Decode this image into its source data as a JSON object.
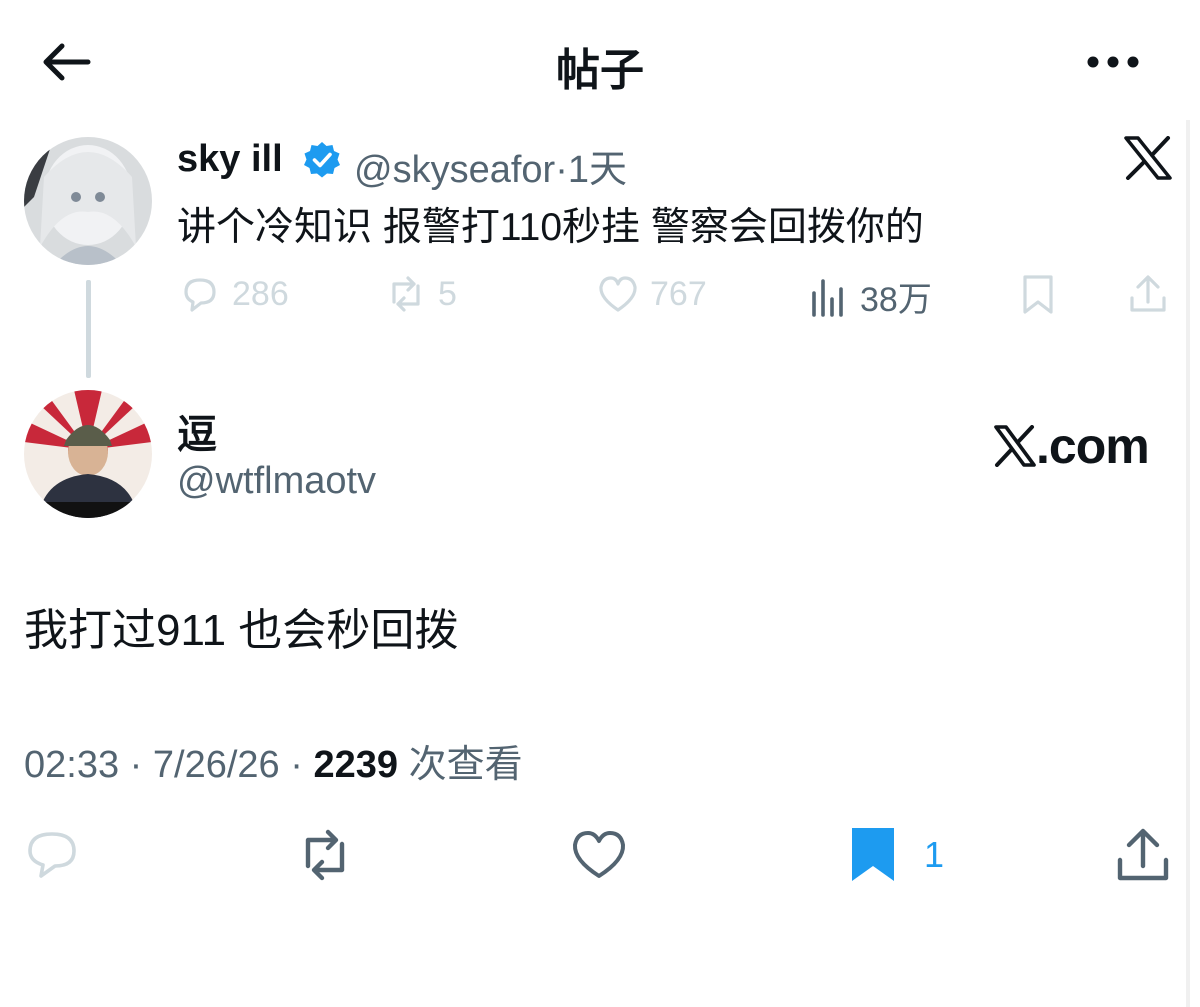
{
  "header": {
    "title": "帖子"
  },
  "parent_tweet": {
    "name": "sky ill",
    "handle": "@skyseafor",
    "separator": "·",
    "time": "1天",
    "text": "讲个冷知识 报警打110秒挂 警察会回拨你的",
    "replies": "286",
    "retweets": "5",
    "likes": "767",
    "views": "38万"
  },
  "main_tweet": {
    "name": "逗",
    "handle": "@wtflmaotv",
    "text": "我打过911 也会秒回拨",
    "time": "02:33",
    "date": "7/26/26",
    "views_count": "2239",
    "views_label": "次查看",
    "bookmarks": "1"
  },
  "watermark": {
    "text": ".com"
  },
  "colors": {
    "accent": "#1d9bf0",
    "secondary_text": "#536471",
    "faint": "#cfd9de"
  },
  "icons": [
    "back-arrow-icon",
    "more-icon",
    "verified-badge-icon",
    "x-logo-icon",
    "reply-icon",
    "retweet-icon",
    "like-icon",
    "views-icon",
    "bookmark-icon",
    "share-icon"
  ]
}
